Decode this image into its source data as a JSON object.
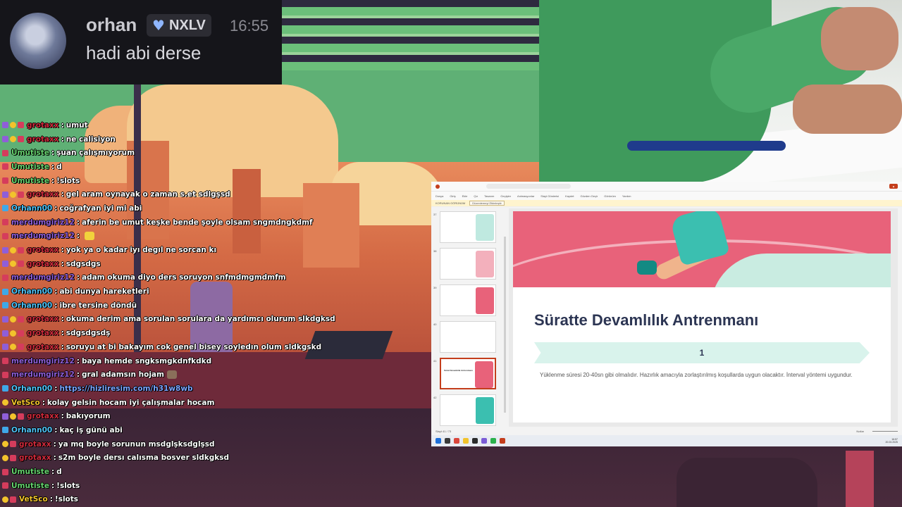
{
  "highlight": {
    "username": "orhan",
    "badge_text": "NXLV",
    "badge_icon": "heart-icon",
    "time": "16:55",
    "message": "hadi abi derse"
  },
  "chat": [
    {
      "badges": [
        "sub",
        "one",
        "mod"
      ],
      "user": "grotaxx",
      "user_color": "#d12a3c",
      "message": "umut"
    },
    {
      "badges": [
        "sub",
        "one",
        "mod"
      ],
      "user": "grotaxx",
      "user_color": "#d12a3c",
      "message": "ne calisiyon"
    },
    {
      "badges": [
        "mod"
      ],
      "user": "Umutiste",
      "user_color": "#66d36e",
      "message": "şuan çalışmıyorum"
    },
    {
      "badges": [
        "mod"
      ],
      "user": "Umutiste",
      "user_color": "#66d36e",
      "message": "d"
    },
    {
      "badges": [
        "mod"
      ],
      "user": "Umutiste",
      "user_color": "#66d36e",
      "message": "!slots"
    },
    {
      "badges": [
        "sub",
        "one",
        "mod"
      ],
      "user": "grotaxx",
      "user_color": "#d12a3c",
      "message": "gel aram oynayak o zaman s.et sdlgşsd"
    },
    {
      "badges": [
        "vip"
      ],
      "user": "Orhann00",
      "user_color": "#4fc3f7",
      "message": "coğrafyan iyi mi abi"
    },
    {
      "badges": [
        "mod"
      ],
      "user": "merdumgiriz12",
      "user_color": "#8f5ed8",
      "message": "aferin be umut keşke bende şoyle olsam sngmdngkdmf"
    },
    {
      "badges": [
        "mod"
      ],
      "user": "merdumgiriz12",
      "user_color": "#8f5ed8",
      "message": ""
    },
    {
      "badges": [
        "sub",
        "one",
        "mod"
      ],
      "user": "grotaxx",
      "user_color": "#d12a3c",
      "message": "yok ya o kadar iyı degıl ne sorcan kı"
    },
    {
      "badges": [
        "sub",
        "one",
        "mod"
      ],
      "user": "grotaxx",
      "user_color": "#d12a3c",
      "message": "sdgsdgs"
    },
    {
      "badges": [
        "mod"
      ],
      "user": "merdumgiriz12",
      "user_color": "#8f5ed8",
      "message": "adam okuma diyo ders soruyon snfmdmgmdmfm"
    },
    {
      "badges": [
        "vip"
      ],
      "user": "Orhann00",
      "user_color": "#4fc3f7",
      "message": "abi dunya hareketleri"
    },
    {
      "badges": [
        "vip"
      ],
      "user": "Orhann00",
      "user_color": "#4fc3f7",
      "message": "ibre tersine döndü"
    },
    {
      "badges": [
        "sub",
        "one",
        "mod"
      ],
      "user": "grotaxx",
      "user_color": "#d12a3c",
      "message": "okuma derim ama sorulan sorulara da yardımcı olurum slkdgksd"
    },
    {
      "badges": [
        "sub",
        "one",
        "mod"
      ],
      "user": "grotaxx",
      "user_color": "#d12a3c",
      "message": "sdgsdgsdş"
    },
    {
      "badges": [
        "sub",
        "one",
        "mod"
      ],
      "user": "grotaxx",
      "user_color": "#d12a3c",
      "message": "soruyu at bi bakayım cok genel bisey soyledın olum sldkgskd"
    },
    {
      "badges": [
        "mod"
      ],
      "user": "merdumgiriz12",
      "user_color": "#8f5ed8",
      "message": "baya hemde sngksmgkdnfkdkd"
    },
    {
      "badges": [
        "mod"
      ],
      "user": "merdumgiriz12",
      "user_color": "#8f5ed8",
      "message": "gral adamsın hojam"
    },
    {
      "badges": [
        "vip"
      ],
      "user": "Orhann00",
      "user_color": "#4fc3f7",
      "message": "https://hizliresim.com/h31w8wb",
      "is_link": true
    },
    {
      "badges": [
        "one"
      ],
      "user": "VetSco",
      "user_color": "#f2c32c",
      "message": "kolay gelsin hocam iyi çalışmalar hocam"
    },
    {
      "badges": [
        "sub",
        "one",
        "mod"
      ],
      "user": "grotaxx",
      "user_color": "#d12a3c",
      "message": "bakıyorum"
    },
    {
      "badges": [
        "vip"
      ],
      "user": "Orhann00",
      "user_color": "#4fc3f7",
      "message": "kaç iş günü abi"
    },
    {
      "badges": [
        "one",
        "mod"
      ],
      "user": "grotaxx",
      "user_color": "#d12a3c",
      "message": "ya mq boyle sorunun msdglşksdglşsd"
    },
    {
      "badges": [
        "one",
        "mod"
      ],
      "user": "grotaxx",
      "user_color": "#d12a3c",
      "message": "s2m boyle dersı calısma bosver sldkgksd"
    },
    {
      "badges": [
        "mod"
      ],
      "user": "Umutiste",
      "user_color": "#66d36e",
      "message": "d"
    },
    {
      "badges": [
        "mod"
      ],
      "user": "Umutiste",
      "user_color": "#66d36e",
      "message": "!slots"
    },
    {
      "badges": [
        "one",
        "mod"
      ],
      "user": "VetSco",
      "user_color": "#f2c32c",
      "message": "!slots"
    }
  ],
  "ppt": {
    "menu_items": [
      "Dosya",
      "Giriş",
      "Ekle",
      "Çiz",
      "Tasarım",
      "Geçişler",
      "Animasyonlar",
      "Slayt Gösterisi",
      "Kaydet",
      "Gözden Geçir",
      "Görünüm",
      "Yardım"
    ],
    "notice_label": "KORUNAN GÖRÜNÜM",
    "notice_button": "Düzenlemeyi Etkinleştir",
    "slides": [
      {
        "num": "37",
        "title": ""
      },
      {
        "num": "38",
        "title": ""
      },
      {
        "num": "39",
        "title": ""
      },
      {
        "num": "40",
        "title": ""
      },
      {
        "num": "41",
        "title": "Sürat Devamlılık Antrenmanı",
        "active": true
      },
      {
        "num": "42",
        "title": ""
      }
    ],
    "slide": {
      "title": "Süratte Devamlılık Antrenmanı",
      "number": "1",
      "body": "Yüklenme süresi 20-40sn gibi olmalıdır. Hazırlık amacıyla zorlaştırılmış koşullarda uygun olacaktır. İnterval yöntemi uygundur."
    },
    "status_left": "Slayt 41 / 73",
    "status_right": "Notlar",
    "clock_time": "16:57",
    "clock_date": "20.03.2025"
  }
}
